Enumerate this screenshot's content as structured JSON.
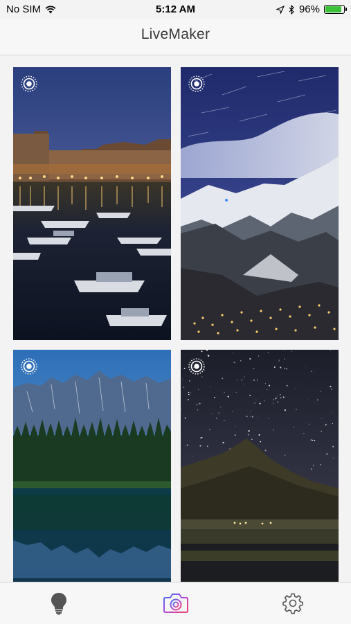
{
  "status_bar": {
    "carrier": "No SIM",
    "time": "5:12 AM",
    "battery_percent": "96%",
    "battery_level": 0.96
  },
  "nav": {
    "title": "LiveMaker"
  },
  "gallery": {
    "items": [
      {
        "name": "harbor-night",
        "live": true
      },
      {
        "name": "mountain-village-star-trails",
        "live": true
      },
      {
        "name": "forest-lake-mountains",
        "live": true
      },
      {
        "name": "starry-sky-mountain",
        "live": true
      }
    ]
  },
  "tab_bar": {
    "tabs": [
      {
        "icon": "lightbulb-icon",
        "active": false
      },
      {
        "icon": "camera-icon",
        "active": true
      },
      {
        "icon": "gear-icon",
        "active": false
      }
    ],
    "active_colors": [
      "#3b6ff5",
      "#b04bd8",
      "#f0466e"
    ],
    "inactive_color": "#555555"
  }
}
